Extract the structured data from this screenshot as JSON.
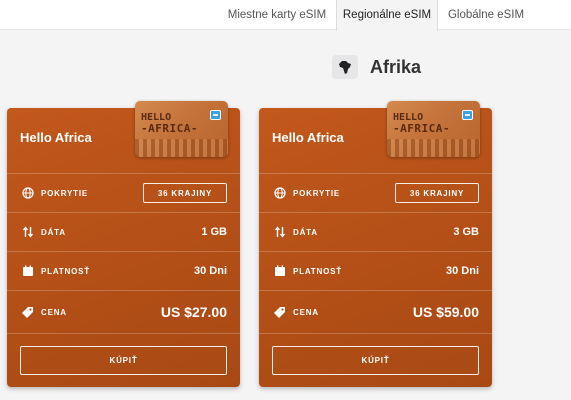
{
  "tabs": [
    {
      "label": "Miestne karty eSIM"
    },
    {
      "label": "Regionálne eSIM"
    },
    {
      "label": "Globálne eSIM"
    }
  ],
  "region": {
    "title": "Afrika",
    "icon": "africa-map-icon"
  },
  "cards": [
    {
      "name": "Hello Africa",
      "sim_line1": "HELLO",
      "sim_line2": "-AFRICA-",
      "coverage_label": "POKRYTIE",
      "coverage_button": "36 KRAJINY",
      "data_label": "DÁTA",
      "data_value": "1 GB",
      "validity_label": "PLATNOSŤ",
      "validity_value": "30 Dni",
      "price_label": "CENA",
      "price_value": "US $27.00",
      "buy_label": "KÚPIŤ"
    },
    {
      "name": "Hello Africa",
      "sim_line1": "HELLO",
      "sim_line2": "-AFRICA-",
      "coverage_label": "POKRYTIE",
      "coverage_button": "36 KRAJINY",
      "data_label": "DÁTA",
      "data_value": "3 GB",
      "validity_label": "PLATNOSŤ",
      "validity_value": "30 Dni",
      "price_label": "CENA",
      "price_value": "US $59.00",
      "buy_label": "KÚPIŤ"
    }
  ],
  "colors": {
    "card_accent": "#b9541a",
    "page_bg": "#f4f4f5"
  }
}
